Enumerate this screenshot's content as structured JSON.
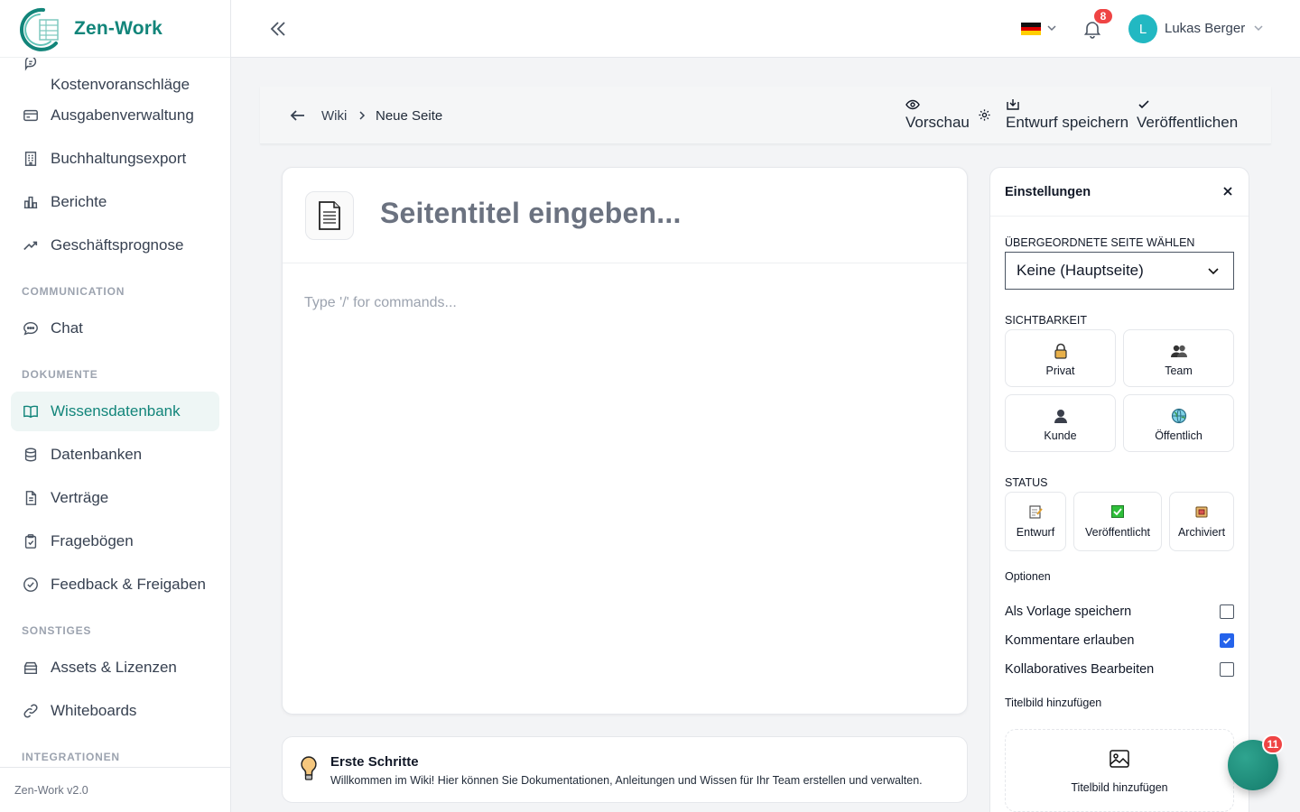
{
  "app": {
    "name": "Zen-Work",
    "version": "Zen-Work v2.0",
    "brand_color": "#12857a"
  },
  "sidebar": {
    "items": [
      {
        "label": "Kostenvoranschläge",
        "icon": "quote-icon"
      },
      {
        "label": "Ausgabenverwaltung",
        "icon": "credit-card-icon"
      },
      {
        "label": "Buchhaltungsexport",
        "icon": "building-icon"
      },
      {
        "label": "Berichte",
        "icon": "bar-chart-icon"
      },
      {
        "label": "Geschäftsprognose",
        "icon": "trend-up-icon"
      },
      {
        "label": "Chat",
        "icon": "chat-icon"
      },
      {
        "label": "Wissensdatenbank",
        "icon": "book-icon",
        "active": true
      },
      {
        "label": "Datenbanken",
        "icon": "database-icon"
      },
      {
        "label": "Verträge",
        "icon": "document-icon"
      },
      {
        "label": "Fragebögen",
        "icon": "clipboard-icon"
      },
      {
        "label": "Feedback & Freigaben",
        "icon": "check-circle-icon"
      },
      {
        "label": "Assets & Lizenzen",
        "icon": "archive-icon"
      },
      {
        "label": "Whiteboards",
        "icon": "link-icon"
      }
    ],
    "sections": [
      "COMMUNICATION",
      "DOKUMENTE",
      "SONSTIGES",
      "INTEGRATIONEN"
    ]
  },
  "topbar": {
    "notifications_count": "8",
    "user": {
      "initial": "L",
      "name": "Lukas Berger"
    },
    "language_flag": "german-flag-icon"
  },
  "header": {
    "breadcrumb": {
      "parent": "Wiki",
      "current": "Neue Seite"
    },
    "preview_label": "Vorschau",
    "save_draft_label": "Entwurf speichern",
    "publish_label": "Veröffentlichen"
  },
  "editor": {
    "title_placeholder": "Seitentitel eingeben...",
    "body_placeholder": "Type '/' for commands..."
  },
  "tips": {
    "title": "Erste Schritte",
    "text": "Willkommen im Wiki! Hier können Sie Dokumentationen, Anleitungen und Wissen für Ihr Team erstellen und verwalten."
  },
  "settings": {
    "title": "Einstellungen",
    "parent_label": "ÜBERGEORDNETE SEITE WÄHLEN",
    "parent_value": "Keine (Hauptseite)",
    "visibility_label": "SICHTBARKEIT",
    "visibility": [
      {
        "label": "Privat",
        "icon": "lock-icon"
      },
      {
        "label": "Team",
        "icon": "team-icon"
      },
      {
        "label": "Kunde",
        "icon": "customer-icon"
      },
      {
        "label": "Öffentlich",
        "icon": "globe-icon"
      }
    ],
    "status_label": "STATUS",
    "status": [
      {
        "label": "Entwurf",
        "icon": "memo-icon"
      },
      {
        "label": "Veröffentlicht",
        "icon": "check-box-icon"
      },
      {
        "label": "Archiviert",
        "icon": "archive-box-icon"
      }
    ],
    "options_label": "Optionen",
    "options": [
      {
        "label": "Als Vorlage speichern",
        "checked": false
      },
      {
        "label": "Kommentare erlauben",
        "checked": true
      },
      {
        "label": "Kollaboratives Bearbeiten",
        "checked": false
      }
    ],
    "cover_label": "Titelbild hinzufügen",
    "cover_button": "Titelbild hinzufügen"
  },
  "fab": {
    "badge": "11"
  }
}
